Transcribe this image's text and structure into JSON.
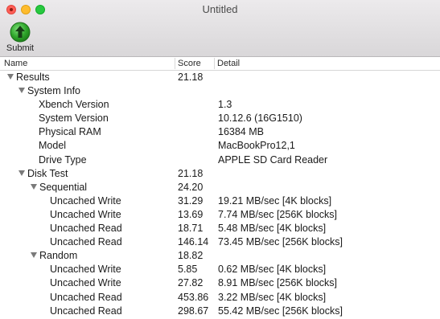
{
  "window": {
    "title": "Untitled"
  },
  "toolbar": {
    "submit_label": "Submit"
  },
  "columns": {
    "name": "Name",
    "score": "Score",
    "detail": "Detail"
  },
  "rows": [
    {
      "name": "Results",
      "score": "21.18",
      "detail": ""
    },
    {
      "name": "System Info",
      "score": "",
      "detail": ""
    },
    {
      "name": "Xbench Version",
      "score": "",
      "detail": "1.3"
    },
    {
      "name": "System Version",
      "score": "",
      "detail": "10.12.6 (16G1510)"
    },
    {
      "name": "Physical RAM",
      "score": "",
      "detail": "16384 MB"
    },
    {
      "name": "Model",
      "score": "",
      "detail": "MacBookPro12,1"
    },
    {
      "name": "Drive Type",
      "score": "",
      "detail": "APPLE SD Card Reader"
    },
    {
      "name": "Disk Test",
      "score": "21.18",
      "detail": ""
    },
    {
      "name": "Sequential",
      "score": "24.20",
      "detail": ""
    },
    {
      "name": "Uncached Write",
      "score": "31.29",
      "detail": "19.21 MB/sec [4K blocks]"
    },
    {
      "name": "Uncached Write",
      "score": "13.69",
      "detail": "7.74 MB/sec [256K blocks]"
    },
    {
      "name": "Uncached Read",
      "score": "18.71",
      "detail": "5.48 MB/sec [4K blocks]"
    },
    {
      "name": "Uncached Read",
      "score": "146.14",
      "detail": "73.45 MB/sec [256K blocks]"
    },
    {
      "name": "Random",
      "score": "18.82",
      "detail": ""
    },
    {
      "name": "Uncached Write",
      "score": "5.85",
      "detail": "0.62 MB/sec [4K blocks]"
    },
    {
      "name": "Uncached Write",
      "score": "27.82",
      "detail": "8.91 MB/sec [256K blocks]"
    },
    {
      "name": "Uncached Read",
      "score": "453.86",
      "detail": "3.22 MB/sec [4K blocks]"
    },
    {
      "name": "Uncached Read",
      "score": "298.67",
      "detail": "55.42 MB/sec [256K blocks]"
    }
  ]
}
